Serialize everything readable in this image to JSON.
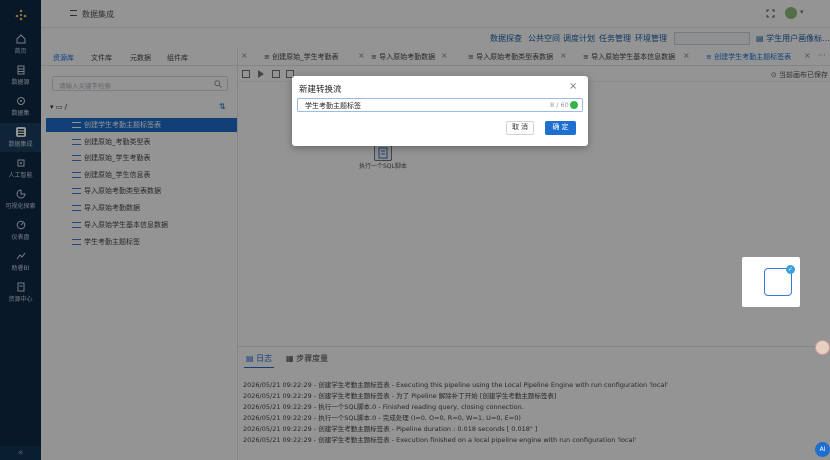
{
  "sidebar": {
    "items": [
      {
        "label": "首页",
        "icon": "home-icon"
      },
      {
        "label": "数据源",
        "icon": "database-icon"
      },
      {
        "label": "数据集",
        "icon": "dataset-icon"
      },
      {
        "label": "数据集成",
        "icon": "integration-icon"
      },
      {
        "label": "人工智能",
        "icon": "ai-icon"
      },
      {
        "label": "可视化探索",
        "icon": "chart-icon"
      },
      {
        "label": "仪表盘",
        "icon": "dashboard-icon"
      },
      {
        "label": "助睿BI",
        "icon": "bi-icon"
      },
      {
        "label": "资源中心",
        "icon": "resource-icon"
      }
    ],
    "collapse_label": "«"
  },
  "header": {
    "breadcrumb": "数据集成"
  },
  "toplinks": [
    "数据探查",
    "公共空间",
    "调度计划",
    "任务管理",
    "环境管理"
  ],
  "toplinks_right": "学生用户画像标...",
  "left_tabs": [
    "资源库",
    "文件库",
    "元数据",
    "组件库"
  ],
  "search": {
    "placeholder": "请输入关键字检索"
  },
  "tree": {
    "root": "/",
    "items": [
      "创建学生考勤主题标签表",
      "创建原始_考勤类型表",
      "创建原始_学生考勤表",
      "创建原始_学生信息表",
      "导入原始考勤类型表数据",
      "导入原始考勤数据",
      "导入原始学生基本信息数据",
      "学生考勤主题标签"
    ]
  },
  "editor_tabs": [
    "创建原始_学生考勤表",
    "导入原始考勤数据",
    "导入原始考勤类型表数据",
    "导入原始学生基本信息数据",
    "创建学生考勤主题标签表"
  ],
  "toolbar": {
    "saved_label": "当前画布已保存"
  },
  "canvas": {
    "node_label": "执行一个SQL脚本"
  },
  "log_panel": {
    "tabs": [
      "日志",
      "步骤度量"
    ],
    "lines": [
      "2026/05/21 09:22:29 - 创建学生考勤主题标签表 - Executing this pipeline using the Local Pipeline Engine with run configuration 'local'",
      "2026/05/21 09:22:29 - 创建学生考勤主题标签表 - 为了 Pipeline 解除补丁开始 [创建学生考勤主题标签表]",
      "2026/05/21 09:22:29 - 执行一个SQL脚本.0 - Finished reading query, closing connection.",
      "2026/05/21 09:22:29 - 执行一个SQL脚本.0 - 完成处理 (I=0, O=0, R=0, W=1, U=0, E=0)",
      "2026/05/21 09:22:29 - 创建学生考勤主题标签表 - Pipeline duration : 0.018 seconds [ 0.018\" ]",
      "2026/05/21 09:22:29 - 创建学生考勤主题标签表 - Execution finished on a local pipeline engine with run configuration 'local'"
    ]
  },
  "modal": {
    "title": "新建转换流",
    "input_value": "学生考勤主题标签",
    "char_count": "8 / 60",
    "cancel_label": "取 消",
    "ok_label": "确 定"
  },
  "ai_badge": "AI",
  "colors": {
    "sidebar": "#0f2a47",
    "accent": "#1e6fd0"
  }
}
